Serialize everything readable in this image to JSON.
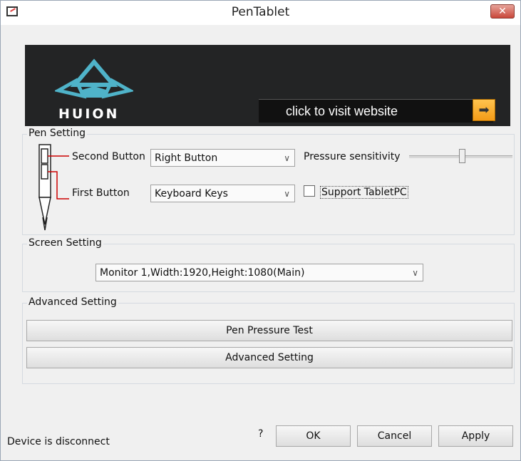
{
  "window": {
    "title": "PenTablet",
    "close": "✕"
  },
  "banner": {
    "brand": "HUION",
    "visit": "click to visit website",
    "arrow": "➡"
  },
  "pen_setting": {
    "legend": "Pen Setting",
    "second_button_label": "Second Button",
    "second_button_value": "Right Button",
    "first_button_label": "First Button",
    "first_button_value": "Keyboard Keys",
    "pressure_label": "Pressure sensitivity",
    "pressure_level": 0.48,
    "support_label": "Support TabletPC",
    "support_checked": false
  },
  "screen_setting": {
    "legend": "Screen Setting",
    "monitor_value": "Monitor 1,Width:1920,Height:1080(Main)"
  },
  "advanced_setting": {
    "legend": "Advanced Setting",
    "pressure_test": "Pen Pressure Test",
    "advanced": "Advanced Setting"
  },
  "footer": {
    "status": "Device is disconnect",
    "help": "?",
    "ok": "OK",
    "cancel": "Cancel",
    "apply": "Apply"
  },
  "colors": {
    "accent": "#f39b17",
    "logo": "#4fb3c9",
    "banner": "#232425"
  }
}
